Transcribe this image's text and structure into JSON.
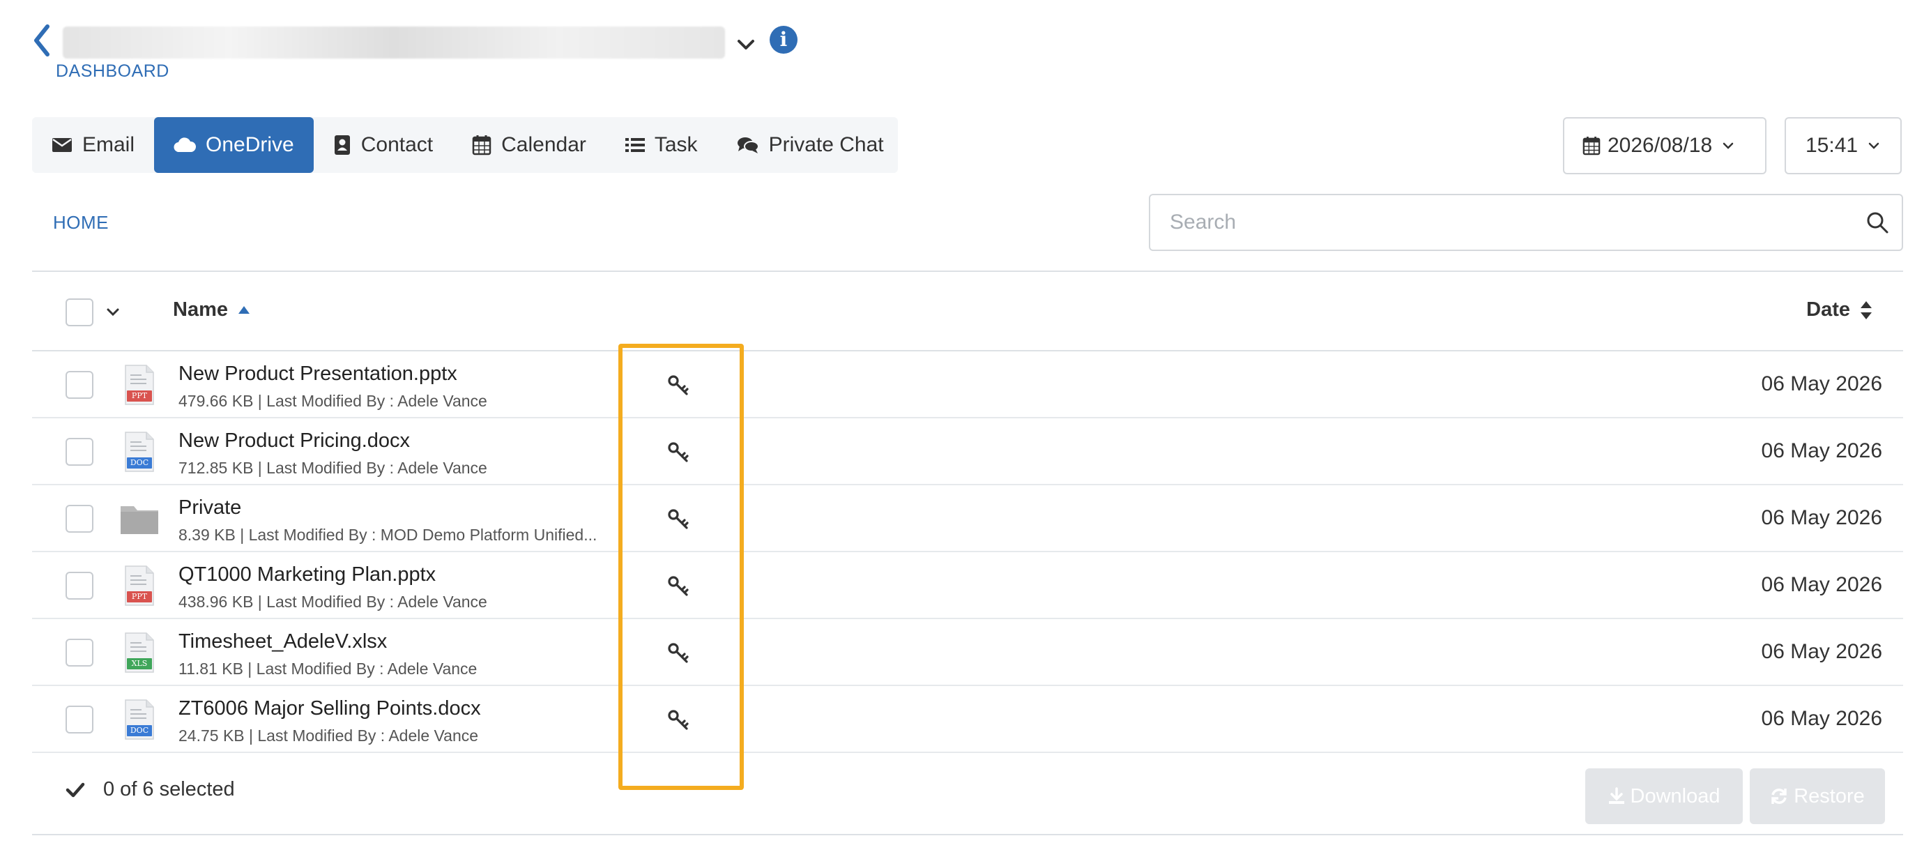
{
  "header": {
    "dashboard_label": "DASHBOARD"
  },
  "tabs": [
    {
      "label": "Email",
      "icon": "envelope-icon"
    },
    {
      "label": "OneDrive",
      "icon": "cloud-icon",
      "active": true
    },
    {
      "label": "Contact",
      "icon": "contact-card-icon"
    },
    {
      "label": "Calendar",
      "icon": "calendar-icon"
    },
    {
      "label": "Task",
      "icon": "list-icon"
    },
    {
      "label": "Private Chat",
      "icon": "chat-bubbles-icon"
    }
  ],
  "date_picker": {
    "value": "2026/08/18"
  },
  "time_picker": {
    "value": "15:41"
  },
  "breadcrumb": {
    "home": "HOME"
  },
  "search": {
    "placeholder": "Search",
    "value": ""
  },
  "table": {
    "columns": {
      "name": "Name",
      "date": "Date"
    },
    "rows": [
      {
        "name": "New Product Presentation.pptx",
        "meta": "479.66 KB | Last Modified By : Adele Vance",
        "date": "06 May 2026",
        "type": "PPT"
      },
      {
        "name": "New Product Pricing.docx",
        "meta": "712.85 KB | Last Modified By : Adele Vance",
        "date": "06 May 2026",
        "type": "DOC"
      },
      {
        "name": "Private",
        "meta": "8.39 KB | Last Modified By : MOD Demo Platform Unified...",
        "date": "06 May 2026",
        "type": "folder"
      },
      {
        "name": "QT1000 Marketing Plan.pptx",
        "meta": "438.96 KB | Last Modified By : Adele Vance",
        "date": "06 May 2026",
        "type": "PPT"
      },
      {
        "name": "Timesheet_AdeleV.xlsx",
        "meta": "11.81 KB | Last Modified By : Adele Vance",
        "date": "06 May 2026",
        "type": "XLS"
      },
      {
        "name": "ZT6006 Major Selling Points.docx",
        "meta": "24.75 KB | Last Modified By : Adele Vance",
        "date": "06 May 2026",
        "type": "DOC"
      }
    ]
  },
  "footer": {
    "selection_status": "0 of 6 selected",
    "download_label": "Download",
    "restore_label": "Restore"
  },
  "colors": {
    "accent": "#2f6db5",
    "highlight": "#f4ac1f",
    "ppt": "#d9534f",
    "doc": "#3a7bd5",
    "xls": "#3fa65a",
    "folder": "#b9b9b9",
    "disabled_button": "#e3e5e8"
  }
}
